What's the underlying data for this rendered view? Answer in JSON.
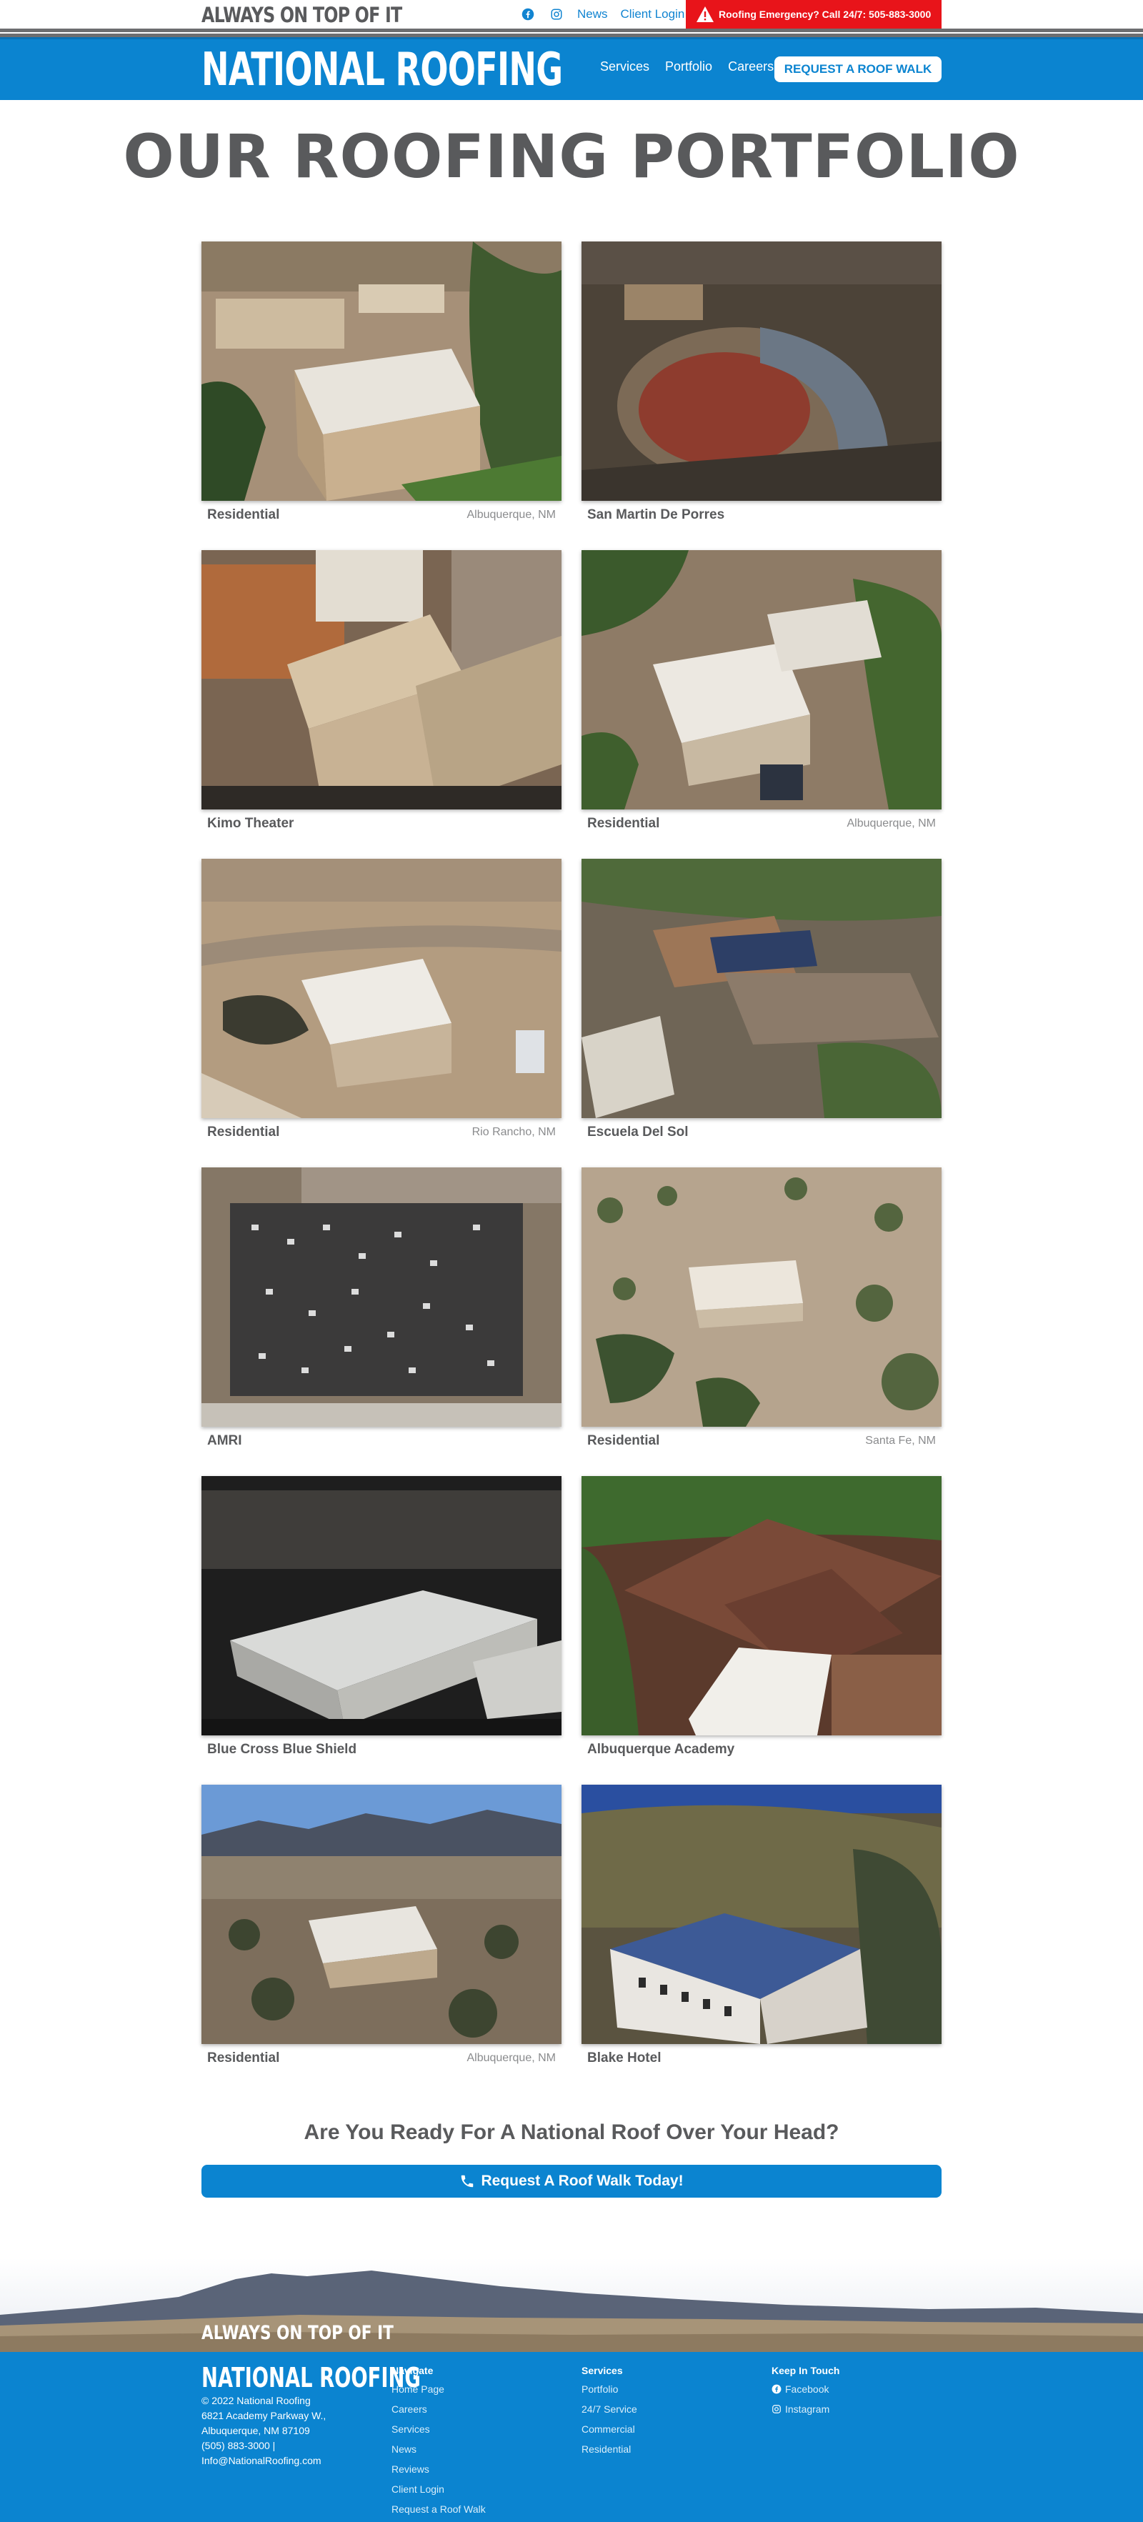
{
  "topbar": {
    "tagline": "ALWAYS ON TOP OF IT",
    "links": [
      {
        "label": "News"
      },
      {
        "label": "Client Login"
      }
    ],
    "emergency": "Roofing Emergency? Call 24/7: 505-883-3000",
    "icons": [
      "facebook-icon",
      "instagram-icon",
      "warning-icon"
    ]
  },
  "nav": {
    "logo": "NATIONAL ROOFING",
    "items": [
      "Services",
      "Portfolio",
      "Careers"
    ],
    "cta": "REQUEST A ROOF WALK",
    "accent": "#0b84d0",
    "emergency_color": "#e8141a"
  },
  "page": {
    "title": "OUR ROOFING PORTFOLIO"
  },
  "portfolio": [
    {
      "title": "Residential",
      "location": "Albuquerque, NM"
    },
    {
      "title": "San Martin De Porres",
      "location": ""
    },
    {
      "title": "Kimo Theater",
      "location": ""
    },
    {
      "title": "Residential",
      "location": "Albuquerque, NM"
    },
    {
      "title": "Residential",
      "location": "Rio Rancho, NM"
    },
    {
      "title": "Escuela Del Sol",
      "location": ""
    },
    {
      "title": "AMRI",
      "location": ""
    },
    {
      "title": "Residential",
      "location": "Santa Fe, NM"
    },
    {
      "title": "Blue Cross Blue Shield",
      "location": ""
    },
    {
      "title": "Albuquerque Academy",
      "location": ""
    },
    {
      "title": "Residential",
      "location": "Albuquerque, NM"
    },
    {
      "title": "Blake Hotel",
      "location": ""
    }
  ],
  "cta": {
    "question": "Are You Ready For A National Roof Over Your Head?",
    "button": "Request A Roof Walk Today!"
  },
  "footer": {
    "tagline": "ALWAYS ON TOP OF IT",
    "logo": "NATIONAL ROOFING",
    "info": [
      "© 2022 National Roofing",
      "6821 Academy Parkway W.,",
      "Albuquerque, NM 87109",
      "(505) 883-3000 |",
      "Info@NationalRoofing.com"
    ],
    "navigate": {
      "heading": "Navigate",
      "links": [
        "Home Page",
        "Careers",
        "Services",
        "News",
        "Reviews",
        "Client Login",
        "Request a Roof Walk"
      ]
    },
    "services": {
      "heading": "Services",
      "links": [
        "Portfolio",
        "24/7 Service",
        "Commercial",
        "Residential"
      ]
    },
    "touch": {
      "heading": "Keep In Touch",
      "links": [
        "Facebook",
        "Instagram"
      ]
    }
  }
}
